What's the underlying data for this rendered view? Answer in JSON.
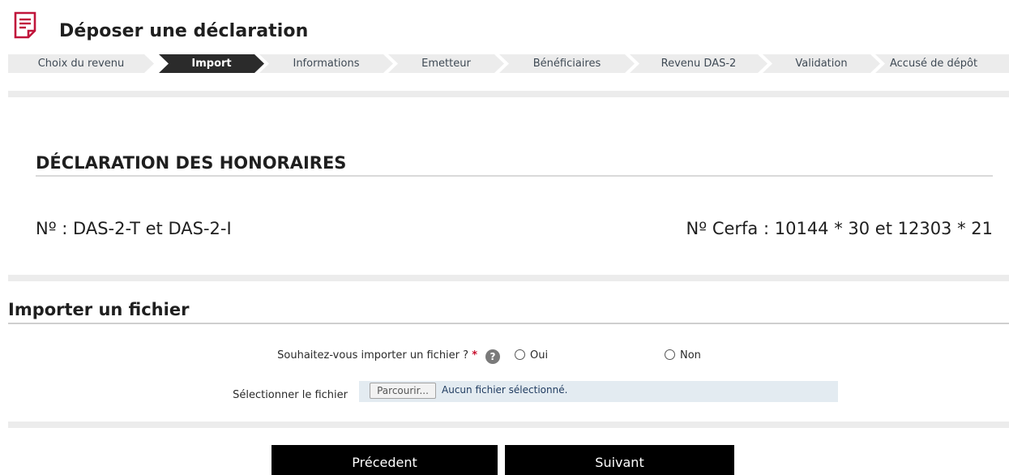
{
  "header": {
    "title": "Déposer une déclaration",
    "icon": "document-icon",
    "icon_color": "#c0153b"
  },
  "steps": [
    {
      "label": "Choix du revenu",
      "active": false
    },
    {
      "label": "Import",
      "active": true
    },
    {
      "label": "Informations",
      "active": false
    },
    {
      "label": "Emetteur",
      "active": false
    },
    {
      "label": "Bénéficiaires",
      "active": false
    },
    {
      "label": "Revenu DAS-2",
      "active": false
    },
    {
      "label": "Validation",
      "active": false
    },
    {
      "label": "Accusé de dépôt",
      "active": false
    }
  ],
  "declaration": {
    "title": "DÉCLARATION DES HONORAIRES",
    "numero": "Nº : DAS-2-T et DAS-2-I",
    "cerfa": "Nº Cerfa : 10144 * 30 et 12303 * 21"
  },
  "import": {
    "title": "Importer un fichier",
    "question": "Souhaitez-vous importer un fichier ?",
    "required_mark": "*",
    "help_icon": "help-icon",
    "help_glyph": "?",
    "option_yes": "Oui",
    "option_no": "Non",
    "file_label": "Sélectionner le fichier",
    "browse_label": "Parcourir...",
    "file_status": "Aucun fichier sélectionné."
  },
  "actions": {
    "previous": "Précedent",
    "next": "Suivant"
  },
  "colors": {
    "active_step": "#2b2b2b",
    "inactive_step": "#ececec",
    "button_bg": "#000000",
    "file_box": "#e3ebf1",
    "required": "#c8102e"
  }
}
